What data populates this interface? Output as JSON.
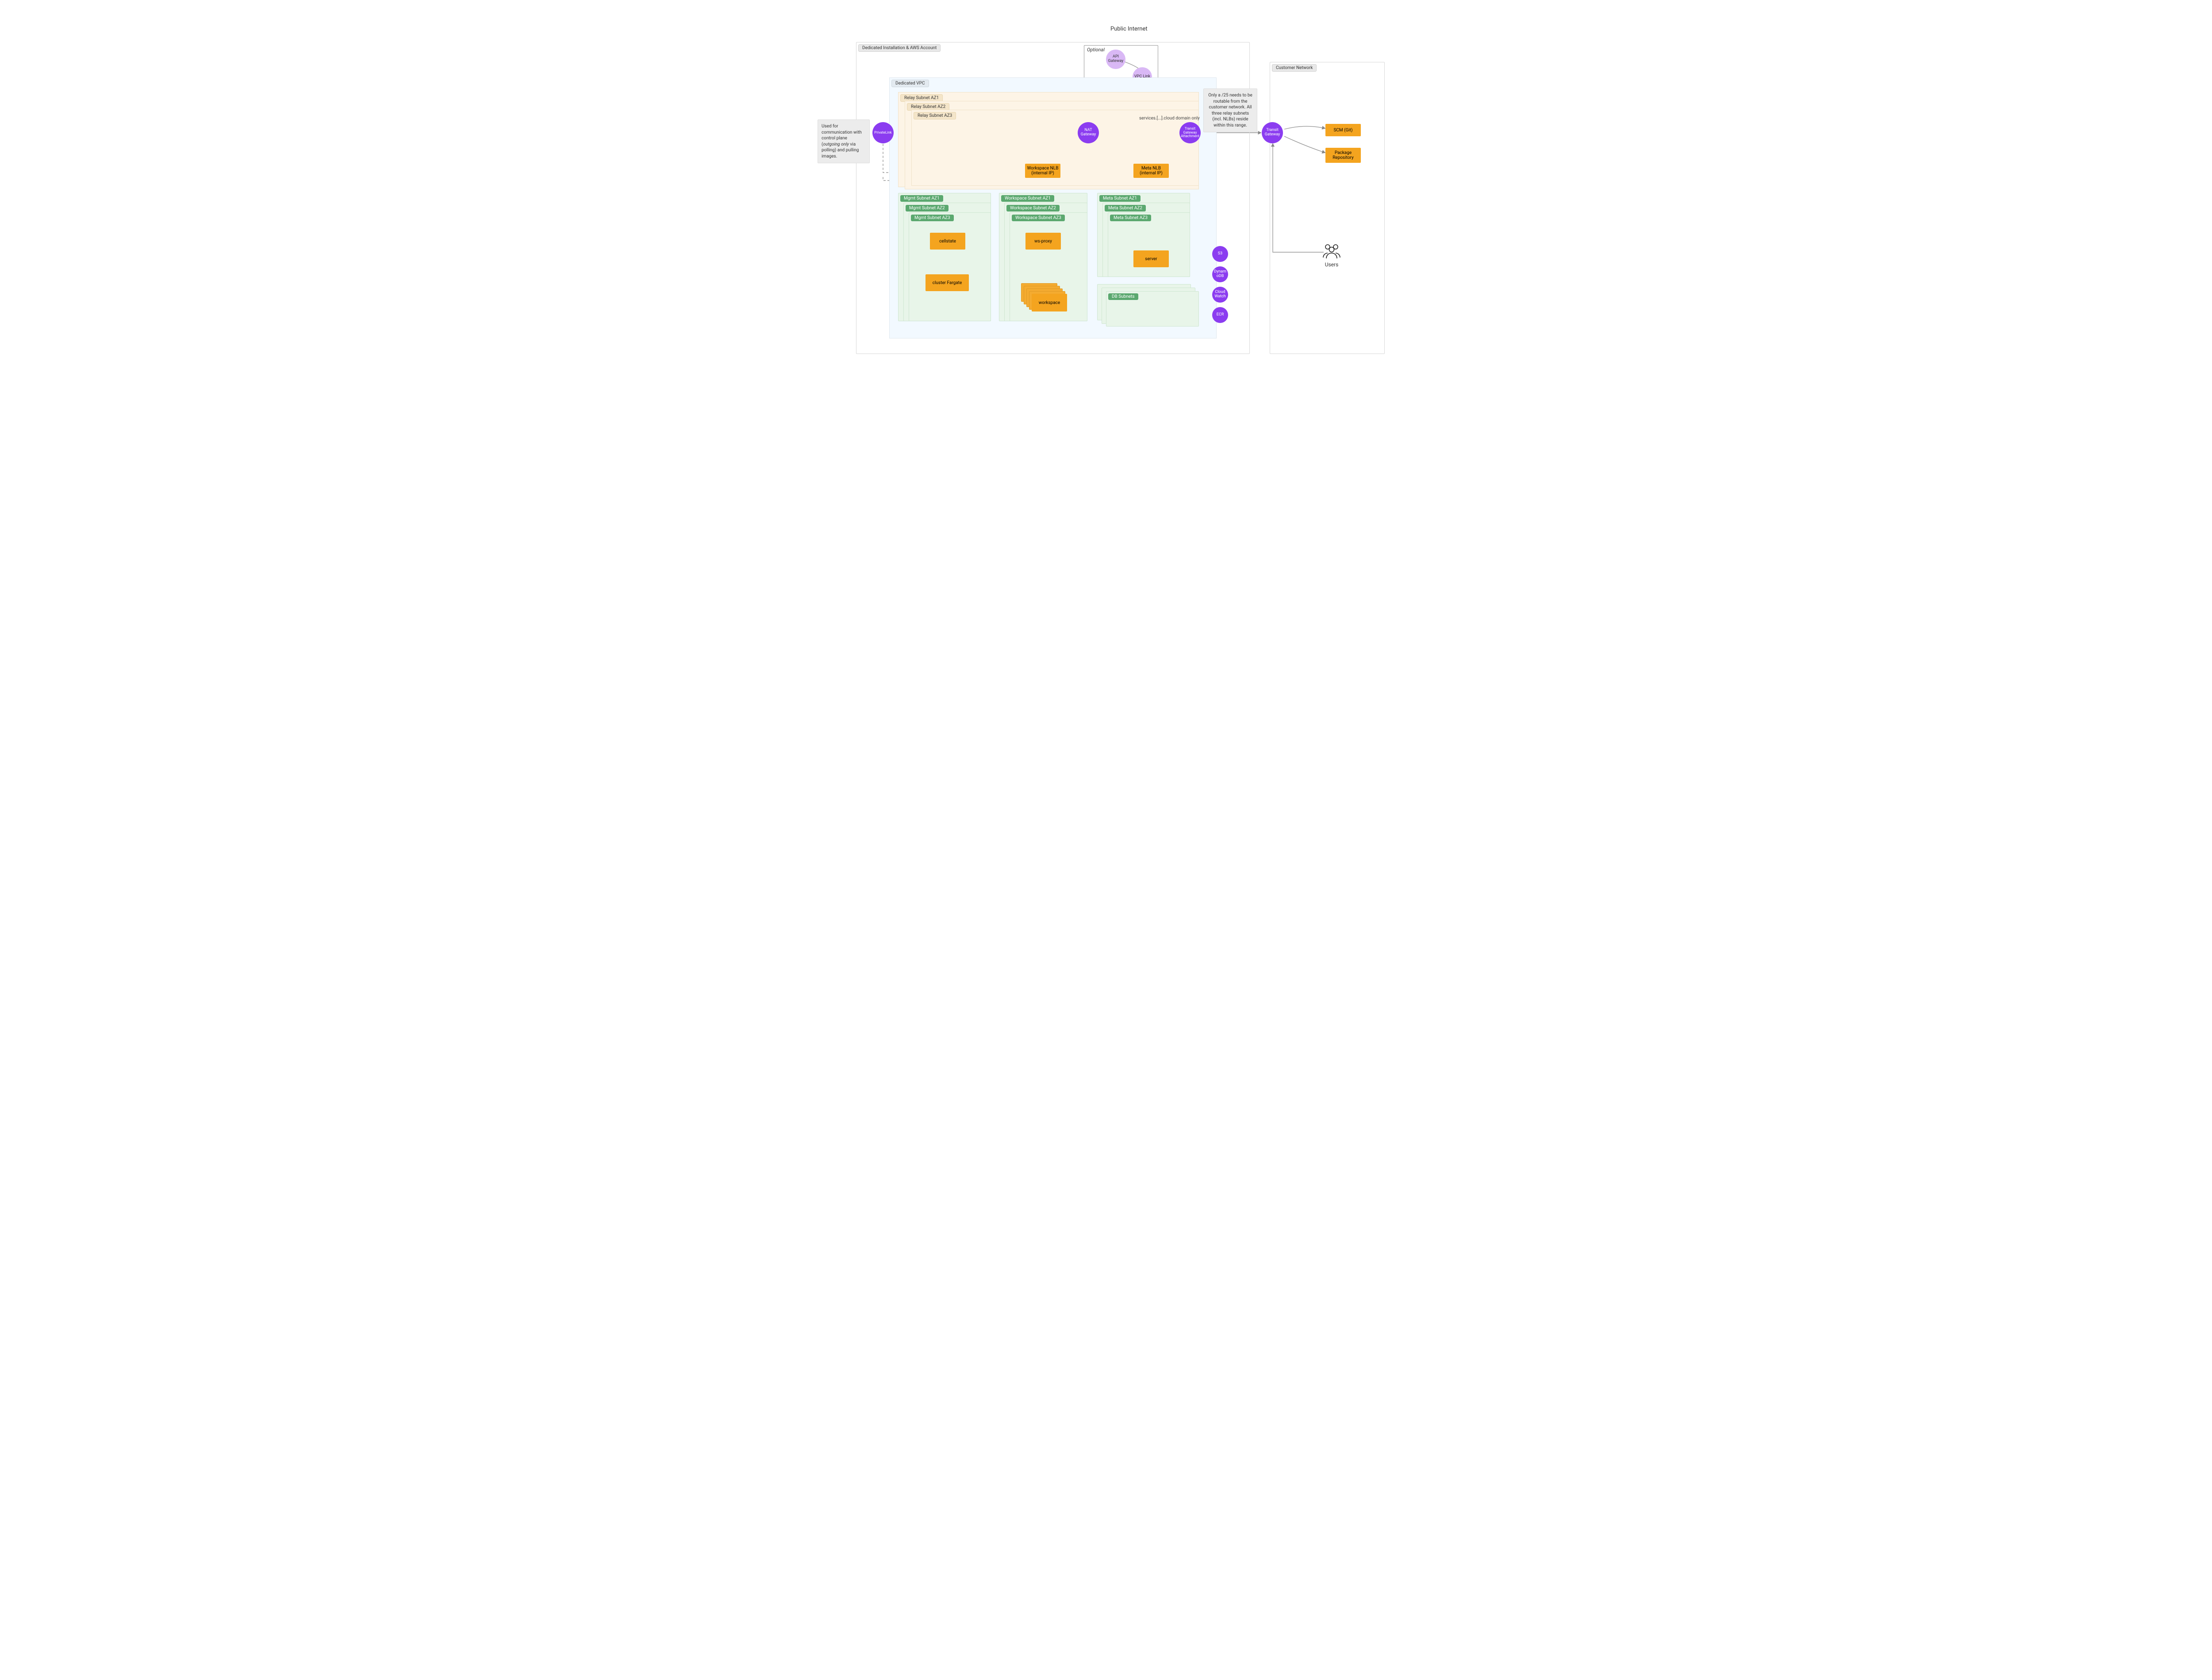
{
  "header": {
    "public_internet": "Public Internet",
    "optional": "Optional"
  },
  "dedicated": {
    "title": "Dedicated Installation & AWS Account"
  },
  "vpc": {
    "title": "Dedicated VPC"
  },
  "relay": {
    "az1": "Relay Subnet AZ1",
    "az2": "Relay Subnet AZ2",
    "az3": "Relay Subnet AZ3"
  },
  "nlb": {
    "workspace": "Workspace NLB (internal IP)",
    "meta": "Meta NLB (internal IP)"
  },
  "subnets": {
    "mgmt": {
      "az1": "Mgmt Subnet AZ1",
      "az2": "Mgmt Subnet AZ2",
      "az3": "Mgmt Subnet AZ3"
    },
    "ws": {
      "az1": "Workspace Subnet AZ1",
      "az2": "Workspace Subnet AZ2",
      "az3": "Workspace Subnet AZ3"
    },
    "meta": {
      "az1": "Meta Subnet AZ1",
      "az2": "Meta Subnet AZ2",
      "az3": "Meta Subnet AZ3"
    },
    "db": {
      "label": "DB Subnets"
    }
  },
  "services": {
    "cellstate": "cellstate",
    "cluster_fargate": "cluster Fargate",
    "ws_proxy": "ws-proxy",
    "workspace": "workspace",
    "server": "server"
  },
  "circles": {
    "privatelink": "PrivateLink",
    "nat_gateway": "NAT Gateway",
    "tgw_attach": "Transit Gateway Attachment",
    "api_gateway": "API Gateway",
    "vpc_link": "VPC Link",
    "transit_gateway": "Transit Gateway",
    "s3": "S3",
    "dynamodb": "Dynam\noDB",
    "cloudwatch": "Cloud\nWatch",
    "ecr": "ECR"
  },
  "customer": {
    "title": "Customer Network",
    "scm": "SCM (Git)",
    "pkg": "Package Repository",
    "users": "Users"
  },
  "notes": {
    "left_pre": "Used for communication with control plane (",
    "left_em": "outgoing only",
    "left_post": " via polling) and pulling images.",
    "right": "Only a /25 needs to be routable from the customer network. All three relay subnets (incl. NLBs) reside within this range.",
    "domain": "services.[...].cloud domain only"
  }
}
